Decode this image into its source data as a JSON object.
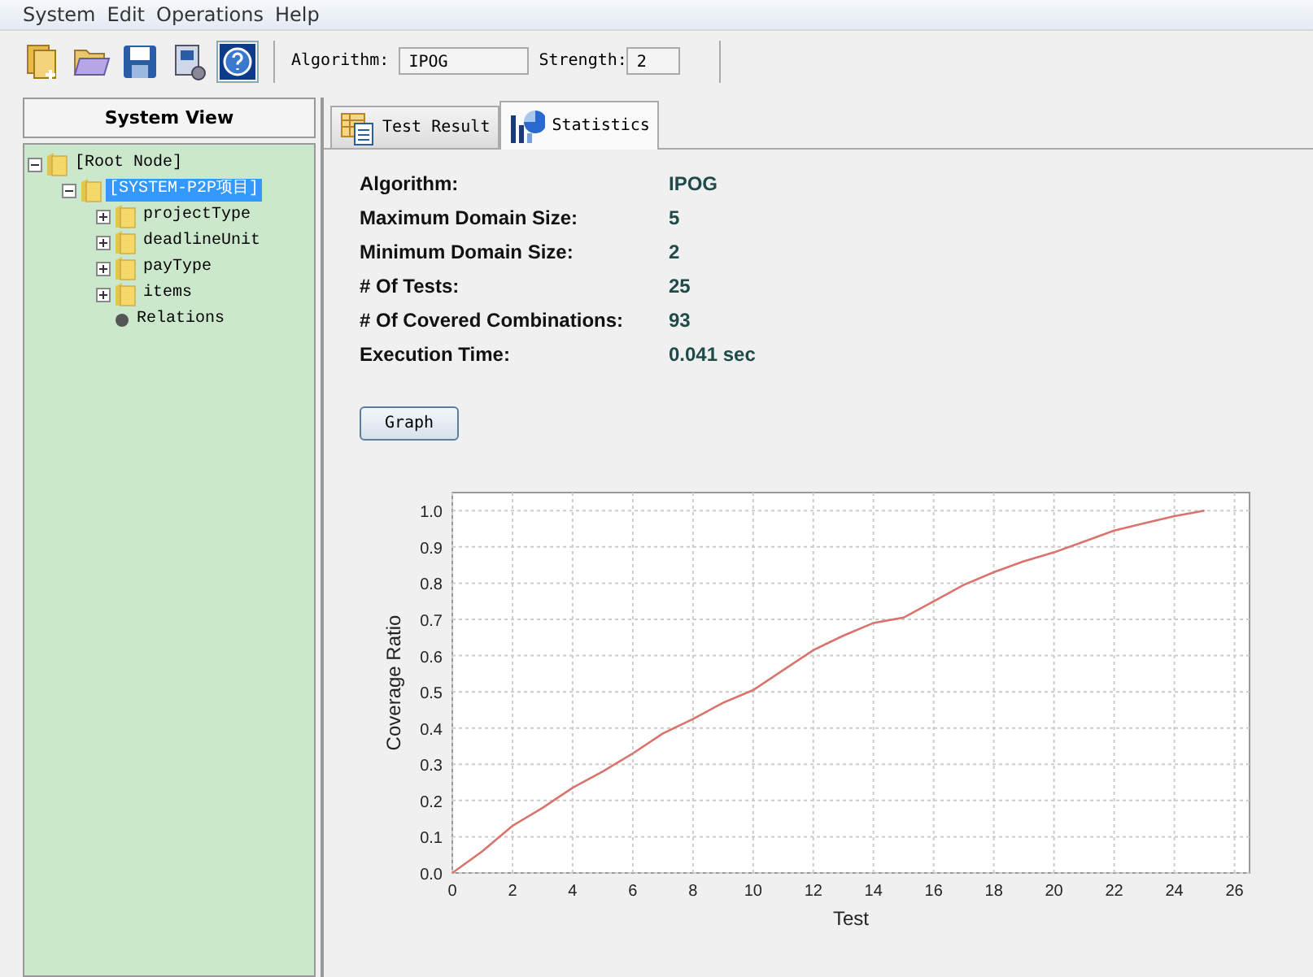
{
  "menu": [
    "System",
    "Edit",
    "Operations",
    "Help"
  ],
  "toolbar": {
    "algorithm_label": "Algorithm:",
    "algorithm": "IPOG",
    "strength_label": "Strength:",
    "strength": "2"
  },
  "sidebar": {
    "title": "System View",
    "tree": [
      {
        "label": "[Root Node]",
        "kind": "folder",
        "expanded": true,
        "selected": false,
        "children": [
          {
            "label": "[SYSTEM-P2P项目]",
            "kind": "folder",
            "expanded": true,
            "selected": true,
            "children": [
              {
                "label": "projectType",
                "kind": "folder",
                "expanded": false,
                "selected": false
              },
              {
                "label": "deadlineUnit",
                "kind": "folder",
                "expanded": false,
                "selected": false
              },
              {
                "label": "payType",
                "kind": "folder",
                "expanded": false,
                "selected": false
              },
              {
                "label": "items",
                "kind": "folder",
                "expanded": false,
                "selected": false
              },
              {
                "label": "Relations",
                "kind": "dot",
                "selected": false
              }
            ]
          }
        ]
      }
    ]
  },
  "tabs": [
    {
      "label": "Test Result",
      "kind": "table",
      "selected": false
    },
    {
      "label": "Statistics",
      "kind": "chart",
      "selected": true
    }
  ],
  "stats": [
    {
      "label": "Algorithm:",
      "value": "IPOG"
    },
    {
      "label": "Maximum Domain Size:",
      "value": "5"
    },
    {
      "label": "Minimum Domain Size:",
      "value": "2"
    },
    {
      "label": "# Of Tests:",
      "value": "25"
    },
    {
      "label": "# Of Covered Combinations:",
      "value": "93"
    },
    {
      "label": "Execution Time:",
      "value": "0.041 sec"
    }
  ],
  "graph_button": "Graph",
  "chart_data": {
    "type": "line",
    "xlabel": "Test",
    "ylabel": "Coverage Ratio",
    "x": [
      0,
      1,
      2,
      3,
      4,
      5,
      6,
      7,
      8,
      9,
      10,
      11,
      12,
      13,
      14,
      15,
      16,
      17,
      18,
      19,
      20,
      21,
      22,
      23,
      24,
      25
    ],
    "grid": true,
    "series": [
      {
        "color": "#d9736b",
        "values": [
          0,
          0.06,
          0.13,
          0.18,
          0.235,
          0.28,
          0.33,
          0.385,
          0.425,
          0.47,
          0.505,
          0.56,
          0.615,
          0.655,
          0.69,
          0.705,
          0.75,
          0.795,
          0.83,
          0.86,
          0.885,
          0.915,
          0.945,
          0.965,
          0.985,
          1.0
        ]
      }
    ],
    "xlim": [
      0,
      26.5
    ],
    "ylim": [
      0,
      1.05
    ],
    "xticks": [
      0,
      2,
      4,
      6,
      8,
      10,
      12,
      14,
      16,
      18,
      20,
      22,
      24,
      26
    ],
    "yticks": [
      {
        "value": 0,
        "label": "0.0"
      },
      {
        "value": 0.1,
        "label": "0.1"
      },
      {
        "value": 0.2,
        "label": "0.2"
      },
      {
        "value": 0.3,
        "label": "0.3"
      },
      {
        "value": 0.4,
        "label": "0.4"
      },
      {
        "value": 0.5,
        "label": "0.5"
      },
      {
        "value": 0.6,
        "label": "0.6"
      },
      {
        "value": 0.7,
        "label": "0.7"
      },
      {
        "value": 0.8,
        "label": "0.8"
      },
      {
        "value": 0.9,
        "label": "0.9"
      },
      {
        "value": 1,
        "label": "1.0"
      }
    ]
  }
}
